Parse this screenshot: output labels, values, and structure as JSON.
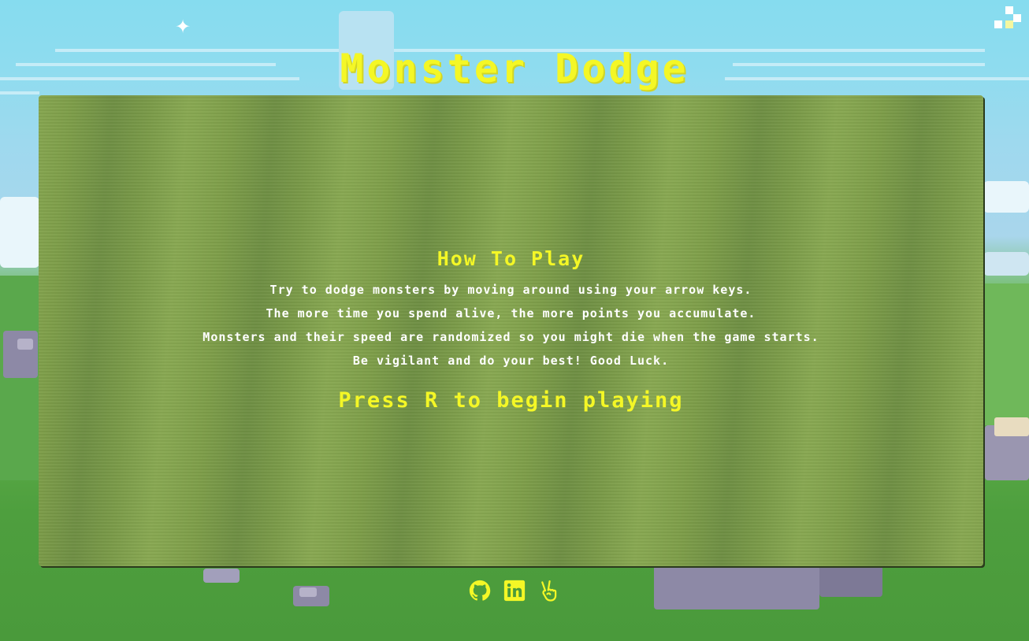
{
  "page": {
    "title": "Monster Dodge"
  },
  "instructions": {
    "heading": "How To Play",
    "lines": [
      "Try to dodge monsters by moving around using your arrow keys.",
      "The more time you spend alive, the more points you accumulate.",
      "Monsters and their speed are randomized so you might die when the game starts.",
      "Be vigilant and do your best! Good Luck."
    ],
    "start_prompt": "Press R to begin playing"
  },
  "footer": {
    "links": [
      {
        "icon": "github-icon"
      },
      {
        "icon": "linkedin-icon"
      },
      {
        "icon": "peace-hand-icon"
      }
    ]
  },
  "colors": {
    "accent_yellow": "#f4f726",
    "instruction_text": "#ffffff",
    "board_green": "#7e9e49",
    "sky": "#86dcef"
  }
}
